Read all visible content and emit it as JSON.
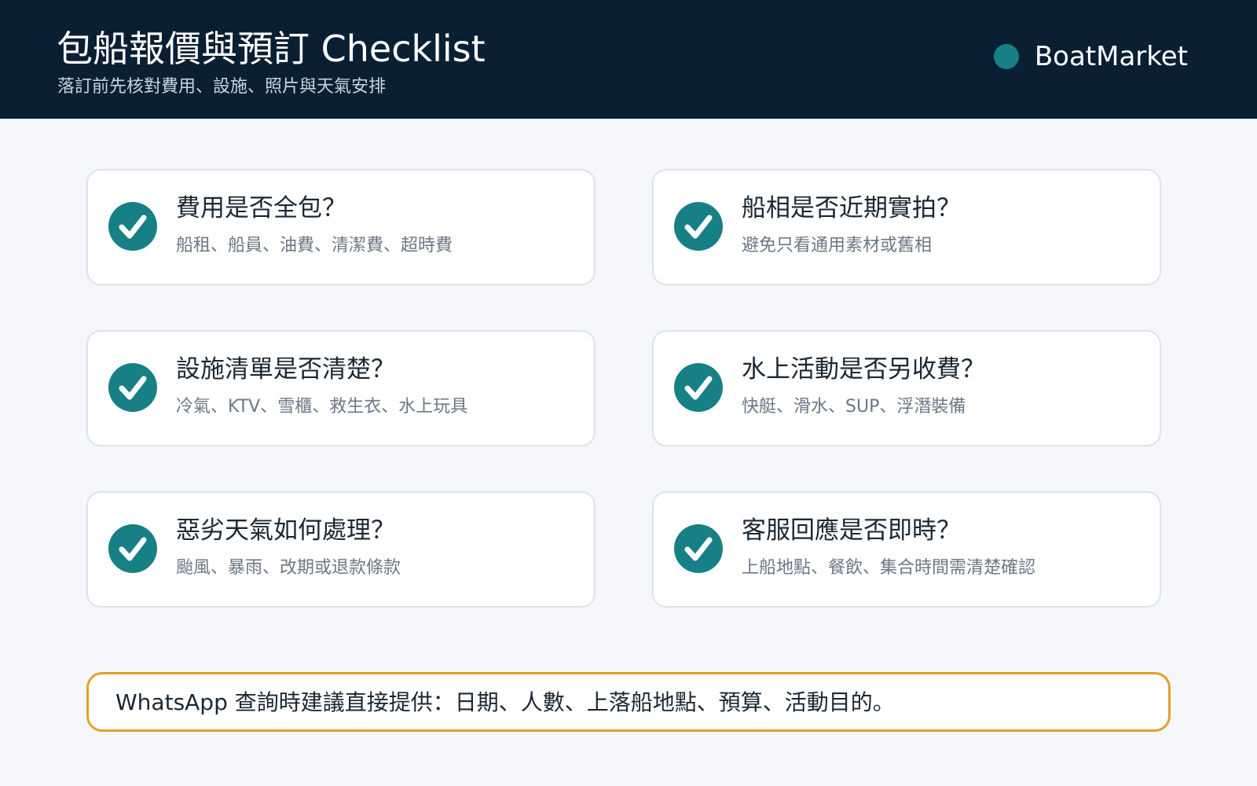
{
  "header": {
    "title": "包船報價與預訂 Checklist",
    "subtitle": "落訂前先核對費用、設施、照片與天氣安排",
    "brand": "BoatMarket"
  },
  "colors": {
    "header_bg": "#0b1f33",
    "accent_teal": "#177f86",
    "note_border": "#e3a02d"
  },
  "checklist": [
    {
      "icon": "check-circle-icon",
      "title": "費用是否全包？",
      "desc": "船租、船員、油費、清潔費、超時費"
    },
    {
      "icon": "check-circle-icon",
      "title": "船相是否近期實拍？",
      "desc": "避免只看通用素材或舊相"
    },
    {
      "icon": "check-circle-icon",
      "title": "設施清單是否清楚？",
      "desc": "冷氣、KTV、雪櫃、救生衣、水上玩具"
    },
    {
      "icon": "check-circle-icon",
      "title": "水上活動是否另收費？",
      "desc": "快艇、滑水、SUP、浮潛裝備"
    },
    {
      "icon": "check-circle-icon",
      "title": "惡劣天氣如何處理？",
      "desc": "颱風、暴雨、改期或退款條款"
    },
    {
      "icon": "check-circle-icon",
      "title": "客服回應是否即時？",
      "desc": "上船地點、餐飲、集合時間需清楚確認"
    }
  ],
  "note": {
    "text": "WhatsApp 查詢時建議直接提供：日期、人數、上落船地點、預算、活動目的。"
  }
}
